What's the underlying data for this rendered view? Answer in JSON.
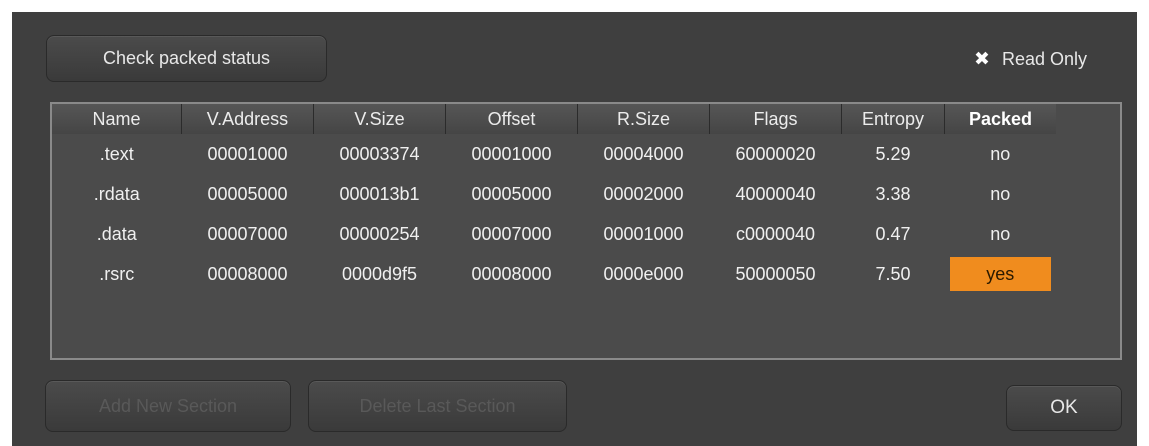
{
  "toolbar": {
    "check_label": "Check packed status",
    "readonly_label": "Read Only",
    "readonly_checked": true
  },
  "table": {
    "columns": [
      "Name",
      "V.Address",
      "V.Size",
      "Offset",
      "R.Size",
      "Flags",
      "Entropy",
      "Packed"
    ],
    "rows": [
      [
        ".text",
        "00001000",
        "00003374",
        "00001000",
        "00004000",
        "60000020",
        "5.29",
        "no"
      ],
      [
        ".rdata",
        "00005000",
        "000013b1",
        "00005000",
        "00002000",
        "40000040",
        "3.38",
        "no"
      ],
      [
        ".data",
        "00007000",
        "00000254",
        "00007000",
        "00001000",
        "c0000040",
        "0.47",
        "no"
      ],
      [
        ".rsrc",
        "00008000",
        "0000d9f5",
        "00008000",
        "0000e000",
        "50000050",
        "7.50",
        "yes"
      ]
    ],
    "packed_highlight_color": "#f08c1e"
  },
  "footer": {
    "add_label": "Add New Section",
    "delete_label": "Delete Last Section",
    "ok_label": "OK"
  }
}
